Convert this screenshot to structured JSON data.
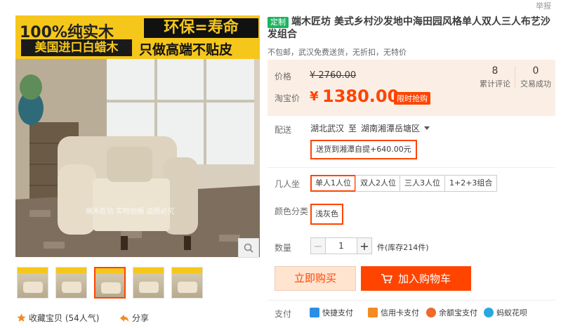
{
  "header": {
    "report_label": "举报"
  },
  "gallery": {
    "banner_line1": "100%纯实木",
    "banner_line2": "美国进口白蜡木",
    "banner_line3": "环保=寿命",
    "banner_line4": "只做高端不贴皮",
    "watermark": "端木匠坊  实物拍摄  盗图必究",
    "thumbnail_count": 5,
    "active_thumbnail": 3
  },
  "social": {
    "favorite_label": "收藏宝贝 (54人气)",
    "share_label": "分享"
  },
  "product": {
    "tag": "定制",
    "title": "端木匠坊 美式乡村沙发地中海田园风格单人双人三人布艺沙发组合",
    "subtitle": "不包邮，武汉免费送货，无折扣，无特价"
  },
  "pricing": {
    "price_label": "价格",
    "original_price": "¥ 2760.00",
    "taobao_label": "淘宝价",
    "currency_symbol": "¥",
    "current_price": "1380.00",
    "promo_label": "限时抢购",
    "reviews_count": "8",
    "reviews_label": "累计评论",
    "trades_count": "0",
    "trades_label": "交易成功"
  },
  "shipping": {
    "label": "配送",
    "from": "湖北武汉",
    "to_word": "至",
    "to": "湖南湘潭岳塘区",
    "fee": "送货到湘潭自提+640.00元"
  },
  "seats": {
    "label": "几人坐",
    "options": [
      "单人1人位",
      "双人2人位",
      "三人3人位",
      "1+2+3组合"
    ],
    "selected": "单人1人位"
  },
  "color": {
    "label": "颜色分类",
    "options": [
      "浅灰色"
    ],
    "selected": "浅灰色"
  },
  "quantity": {
    "label": "数量",
    "value": "1",
    "minus": "−",
    "plus": "+",
    "stock_text": "件(库存214件)"
  },
  "actions": {
    "buy_now": "立即购买",
    "add_to_cart": "加入购物车"
  },
  "payment": {
    "label": "支付",
    "methods": [
      "快捷支付",
      "信用卡支付",
      "余额宝支付",
      "蚂蚁花呗"
    ]
  },
  "colors": {
    "accent": "#ff4400",
    "price_bg": "#fbefe5",
    "tag_green": "#1bb45e",
    "banner_yellow": "#f6c71b"
  }
}
